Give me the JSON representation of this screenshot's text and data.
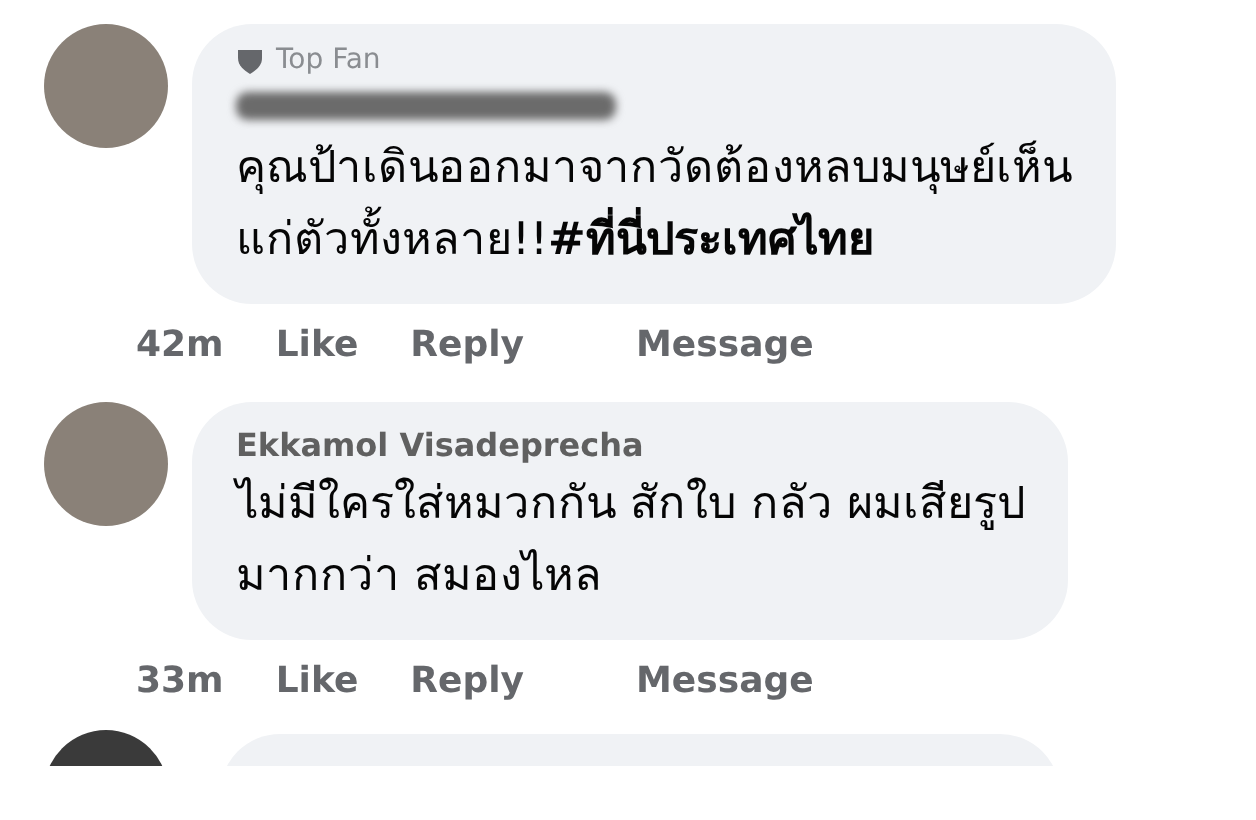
{
  "comments": [
    {
      "badge": {
        "label": "Top Fan"
      },
      "author": {
        "kind": "blurred"
      },
      "text": "คุณป้าเดินออกมาจากวัดต้องหลบมนุษย์เห็น\nแก่ตัวทั้งหลาย!!**#ที่นี่ประเทศไทย**",
      "time": "42m",
      "actions": [
        "Like",
        "Reply",
        "Message"
      ]
    },
    {
      "author": {
        "kind": "text",
        "name": "Ekkamol Visadeprecha"
      },
      "text": "ไม่มีใครใส่หมวกกัน สักใบ กลัว ผมเสียรูป\nมากกว่า สมองไหล",
      "time": "33m",
      "actions": [
        "Like",
        "Reply",
        "Message"
      ]
    }
  ]
}
